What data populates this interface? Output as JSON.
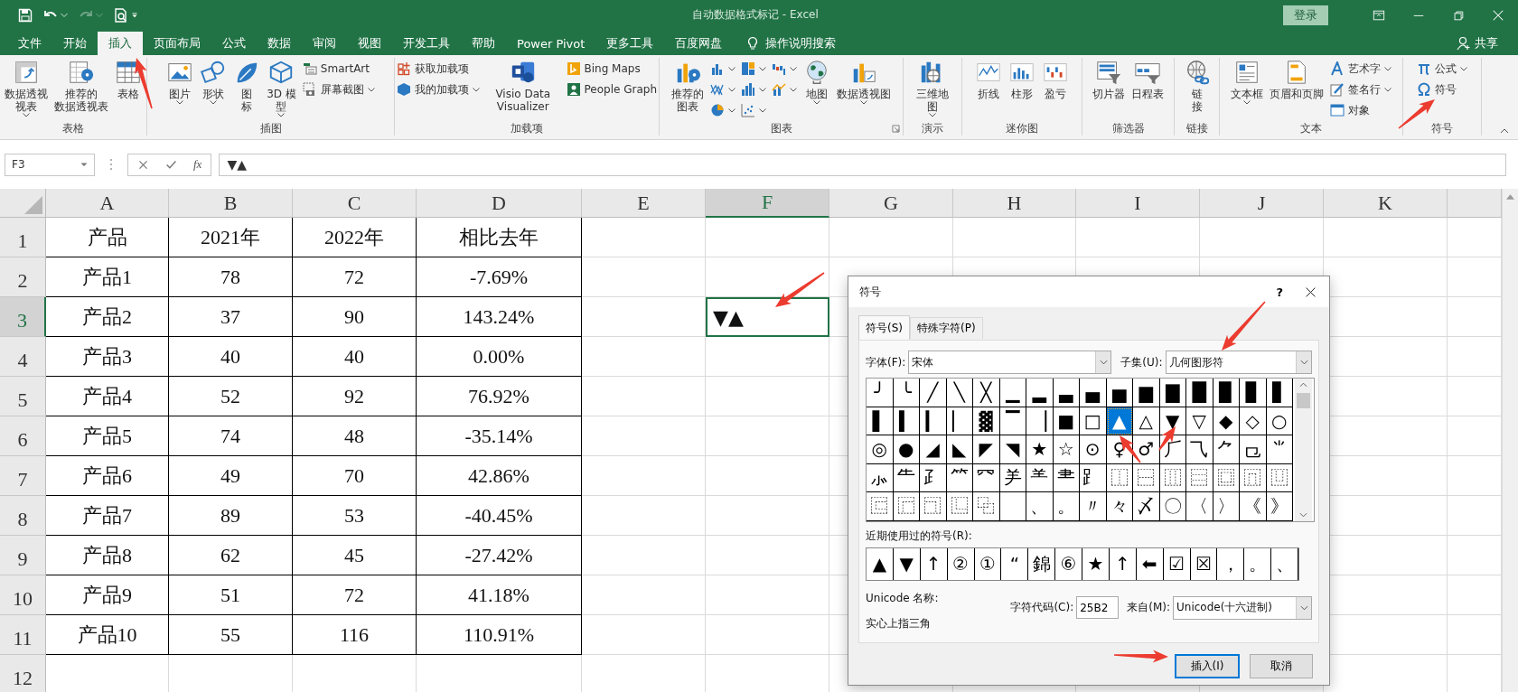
{
  "window": {
    "title": "自动数据格式标记 - Excel",
    "sign_in": "登录"
  },
  "menu_tabs": [
    {
      "label": "文件",
      "selected": false
    },
    {
      "label": "开始",
      "selected": false
    },
    {
      "label": "插入",
      "selected": true
    },
    {
      "label": "页面布局",
      "selected": false
    },
    {
      "label": "公式",
      "selected": false
    },
    {
      "label": "数据",
      "selected": false
    },
    {
      "label": "审阅",
      "selected": false
    },
    {
      "label": "视图",
      "selected": false
    },
    {
      "label": "开发工具",
      "selected": false
    },
    {
      "label": "帮助",
      "selected": false
    },
    {
      "label": "Power Pivot",
      "selected": false
    },
    {
      "label": "更多工具",
      "selected": false
    },
    {
      "label": "百度网盘",
      "selected": false
    }
  ],
  "tell_me": "操作说明搜索",
  "share": "共享",
  "ribbon": {
    "groups": [
      {
        "label": "表格",
        "launcher": false,
        "columns": [
          {
            "kind": "large",
            "label": "数据透视视表",
            "dropdown": true
          },
          {
            "kind": "large",
            "label": "推荐的数据透视表",
            "dropdown": false
          },
          {
            "kind": "large",
            "label": "表格",
            "dropdown": false
          }
        ]
      },
      {
        "label": "插图",
        "launcher": false,
        "columns": [
          {
            "kind": "large",
            "label": "图片",
            "dropdown": true
          },
          {
            "kind": "large",
            "label": "形状",
            "dropdown": true
          },
          {
            "kind": "large",
            "label": "图标",
            "dropdown": false
          },
          {
            "kind": "large",
            "label": "3D 模型",
            "dropdown": true
          },
          {
            "kind": "stack",
            "buttons": [
              {
                "label": "SmartArt",
                "dropdown": false
              },
              {
                "label": "屏幕截图",
                "dropdown": true
              }
            ]
          }
        ]
      },
      {
        "label": "加载项",
        "launcher": false,
        "columns": [
          {
            "kind": "stack",
            "buttons": [
              {
                "label": "获取加载项",
                "dropdown": false
              },
              {
                "label": "我的加载项",
                "dropdown": true
              }
            ]
          },
          {
            "kind": "large",
            "label": "Visio Data Visualizer",
            "dropdown": false
          },
          {
            "kind": "stack",
            "buttons": [
              {
                "label": "Bing Maps",
                "dropdown": false
              },
              {
                "label": "People Graph",
                "dropdown": false
              }
            ]
          }
        ]
      },
      {
        "label": "图表",
        "launcher": true,
        "columns": [
          {
            "kind": "large",
            "label": "推荐的图表",
            "dropdown": false
          },
          {
            "kind": "icons",
            "buttons": [
              {
                "dropdown": true
              },
              {
                "dropdown": true
              },
              {
                "dropdown": true
              },
              {
                "dropdown": true
              },
              {
                "dropdown": true
              },
              {
                "dropdown": true
              },
              {
                "dropdown": true
              },
              {
                "dropdown": true
              }
            ]
          },
          {
            "kind": "large",
            "label": "地图",
            "dropdown": true
          },
          {
            "kind": "large",
            "label": "数据透视图",
            "dropdown": true
          }
        ]
      },
      {
        "label": "演示",
        "launcher": false,
        "columns": [
          {
            "kind": "large",
            "label": "三维地图",
            "dropdown": true
          }
        ]
      },
      {
        "label": "迷你图",
        "launcher": false,
        "columns": [
          {
            "kind": "large",
            "label": "折线",
            "dropdown": false
          },
          {
            "kind": "large",
            "label": "柱形",
            "dropdown": false
          },
          {
            "kind": "large",
            "label": "盈亏",
            "dropdown": false
          }
        ]
      },
      {
        "label": "筛选器",
        "launcher": false,
        "columns": [
          {
            "kind": "large",
            "label": "切片器",
            "dropdown": false
          },
          {
            "kind": "large",
            "label": "日程表",
            "dropdown": false
          }
        ]
      },
      {
        "label": "链接",
        "launcher": false,
        "columns": [
          {
            "kind": "large",
            "label": "链接",
            "dropdown": false
          }
        ]
      },
      {
        "label": "文本",
        "launcher": false,
        "columns": [
          {
            "kind": "large",
            "label": "文本框",
            "dropdown": true
          },
          {
            "kind": "large",
            "label": "页眉和页脚",
            "dropdown": false
          },
          {
            "kind": "stack",
            "buttons": [
              {
                "label": "艺术字",
                "dropdown": true
              },
              {
                "label": "签名行",
                "dropdown": true
              },
              {
                "label": "对象",
                "dropdown": false
              }
            ]
          }
        ]
      },
      {
        "label": "符号",
        "launcher": false,
        "columns": [
          {
            "kind": "stack",
            "buttons": [
              {
                "label": "公式",
                "dropdown": true
              },
              {
                "label": "符号",
                "dropdown": false
              }
            ]
          }
        ]
      }
    ]
  },
  "formula_bar": {
    "name_box": "F3",
    "fx": "fx",
    "value": "▼▲"
  },
  "sheet": {
    "columns": [
      {
        "label": "A",
        "selected": false
      },
      {
        "label": "B",
        "selected": false
      },
      {
        "label": "C",
        "selected": false
      },
      {
        "label": "D",
        "selected": false
      },
      {
        "label": "E",
        "selected": false
      },
      {
        "label": "F",
        "selected": true
      },
      {
        "label": "G",
        "selected": false
      },
      {
        "label": "H",
        "selected": false
      },
      {
        "label": "I",
        "selected": false
      },
      {
        "label": "J",
        "selected": false
      },
      {
        "label": "K",
        "selected": false
      }
    ],
    "rows": [
      {
        "header": "1",
        "selected": false,
        "cells": [
          "产品",
          "2021年",
          "2022年",
          "相比去年"
        ]
      },
      {
        "header": "2",
        "selected": false,
        "cells": [
          "产品1",
          "78",
          "72",
          "-7.69%"
        ]
      },
      {
        "header": "3",
        "selected": true,
        "cells": [
          "产品2",
          "37",
          "90",
          "143.24%"
        ]
      },
      {
        "header": "4",
        "selected": false,
        "cells": [
          "产品3",
          "40",
          "40",
          "0.00%"
        ]
      },
      {
        "header": "5",
        "selected": false,
        "cells": [
          "产品4",
          "52",
          "92",
          "76.92%"
        ]
      },
      {
        "header": "6",
        "selected": false,
        "cells": [
          "产品5",
          "74",
          "48",
          "-35.14%"
        ]
      },
      {
        "header": "7",
        "selected": false,
        "cells": [
          "产品6",
          "49",
          "70",
          "42.86%"
        ]
      },
      {
        "header": "8",
        "selected": false,
        "cells": [
          "产品7",
          "89",
          "53",
          "-40.45%"
        ]
      },
      {
        "header": "9",
        "selected": false,
        "cells": [
          "产品8",
          "62",
          "45",
          "-27.42%"
        ]
      },
      {
        "header": "10",
        "selected": false,
        "cells": [
          "产品9",
          "51",
          "72",
          "41.18%"
        ]
      },
      {
        "header": "11",
        "selected": false,
        "cells": [
          "产品10",
          "55",
          "116",
          "110.91%"
        ]
      },
      {
        "header": "12",
        "selected": false,
        "cells": []
      }
    ],
    "active_cell": {
      "text": "▼▲"
    }
  },
  "dialog": {
    "title": "符号",
    "help": "?",
    "tabs": [
      {
        "label": "符号(S)",
        "selected": true
      },
      {
        "label": "特殊字符(P)",
        "selected": false
      }
    ],
    "font_label": "字体(F):",
    "font_value": "宋体",
    "subset_label": "子集(U):",
    "subset_value": "几何图形符",
    "symbols": [
      [
        {
          "char": "╯",
          "selected": false
        },
        {
          "char": "╰",
          "selected": false
        },
        {
          "char": "╱",
          "selected": false
        },
        {
          "char": "╲",
          "selected": false
        },
        {
          "char": "╳",
          "selected": false
        },
        {
          "char": "▁",
          "selected": false
        },
        {
          "char": "▂",
          "selected": false
        },
        {
          "char": "▃",
          "selected": false
        },
        {
          "char": "▄",
          "selected": false
        },
        {
          "char": "▅",
          "selected": false
        },
        {
          "char": "▆",
          "selected": false
        },
        {
          "char": "▇",
          "selected": false
        },
        {
          "char": "█",
          "selected": false
        },
        {
          "char": "▉",
          "selected": false
        },
        {
          "char": "▊",
          "selected": false
        },
        {
          "char": "▋",
          "selected": false
        }
      ],
      [
        {
          "char": "▌",
          "selected": false
        },
        {
          "char": "▍",
          "selected": false
        },
        {
          "char": "▎",
          "selected": false
        },
        {
          "char": "▏",
          "selected": false
        },
        {
          "char": "▓",
          "selected": false
        },
        {
          "char": "▔",
          "selected": false
        },
        {
          "char": "▕",
          "selected": false
        },
        {
          "char": "■",
          "selected": false
        },
        {
          "char": "□",
          "selected": false
        },
        {
          "char": "▲",
          "selected": true
        },
        {
          "char": "△",
          "selected": false
        },
        {
          "char": "▼",
          "selected": false
        },
        {
          "char": "▽",
          "selected": false
        },
        {
          "char": "◆",
          "selected": false
        },
        {
          "char": "◇",
          "selected": false
        },
        {
          "char": "○",
          "selected": false
        }
      ],
      [
        {
          "char": "◎",
          "selected": false
        },
        {
          "char": "●",
          "selected": false
        },
        {
          "char": "◢",
          "selected": false
        },
        {
          "char": "◣",
          "selected": false
        },
        {
          "char": "◤",
          "selected": false
        },
        {
          "char": "◥",
          "selected": false
        },
        {
          "char": "★",
          "selected": false
        },
        {
          "char": "☆",
          "selected": false
        },
        {
          "char": "⊙",
          "selected": false
        },
        {
          "char": "♀",
          "selected": false
        },
        {
          "char": "♂",
          "selected": false
        },
        {
          "char": "⺁",
          "selected": false
        },
        {
          "char": "⺄",
          "selected": false
        },
        {
          "char": "⺈",
          "selected": false
        },
        {
          "char": "⺋",
          "selected": false
        },
        {
          "char": "⺌",
          "selected": false
        }
      ],
      [
        {
          "char": "⺗",
          "selected": false
        },
        {
          "char": "⺧",
          "selected": false
        },
        {
          "char": "⺪",
          "selected": false
        },
        {
          "char": "⺮",
          "selected": false
        },
        {
          "char": "⺳",
          "selected": false
        },
        {
          "char": "⺶",
          "selected": false
        },
        {
          "char": "⺷",
          "selected": false
        },
        {
          "char": "⺻",
          "selected": false
        },
        {
          "char": "⻊",
          "selected": false
        },
        {
          "char": "⿰",
          "selected": false
        },
        {
          "char": "⿱",
          "selected": false
        },
        {
          "char": "⿲",
          "selected": false
        },
        {
          "char": "⿳",
          "selected": false
        },
        {
          "char": "⿴",
          "selected": false
        },
        {
          "char": "⿵",
          "selected": false
        },
        {
          "char": "⿶",
          "selected": false
        }
      ],
      [
        {
          "char": "⿷",
          "selected": false
        },
        {
          "char": "⿸",
          "selected": false
        },
        {
          "char": "⿹",
          "selected": false
        },
        {
          "char": "⿺",
          "selected": false
        },
        {
          "char": "⿻",
          "selected": false
        },
        {
          "selected": false
        },
        {
          "char": "、",
          "selected": false
        },
        {
          "char": "。",
          "selected": false
        },
        {
          "char": "〃",
          "selected": false
        },
        {
          "char": "々",
          "selected": false
        },
        {
          "char": "〆",
          "selected": false
        },
        {
          "char": "〇",
          "selected": false
        },
        {
          "char": "〈",
          "selected": false
        },
        {
          "char": "〉",
          "selected": false
        },
        {
          "char": "《",
          "selected": false
        },
        {
          "char": "》",
          "selected": false
        }
      ]
    ],
    "recent_label": "近期使用过的符号(R):",
    "recent": [
      "▲",
      "▼",
      "↑",
      "②",
      "①",
      "“",
      "錦",
      "⑥",
      "★",
      "↑",
      "⬅",
      "☑",
      "☒",
      "，",
      "。",
      "、"
    ],
    "unicode_name_label": "Unicode 名称:",
    "unicode_name": "实心上指三角",
    "code_label": "字符代码(C):",
    "code_value": "25B2",
    "from_label": "来自(M):",
    "from_value": "Unicode(十六进制)",
    "buttons": [
      {
        "label": "插入(I)",
        "default": true
      },
      {
        "label": "取消",
        "default": false
      }
    ]
  }
}
